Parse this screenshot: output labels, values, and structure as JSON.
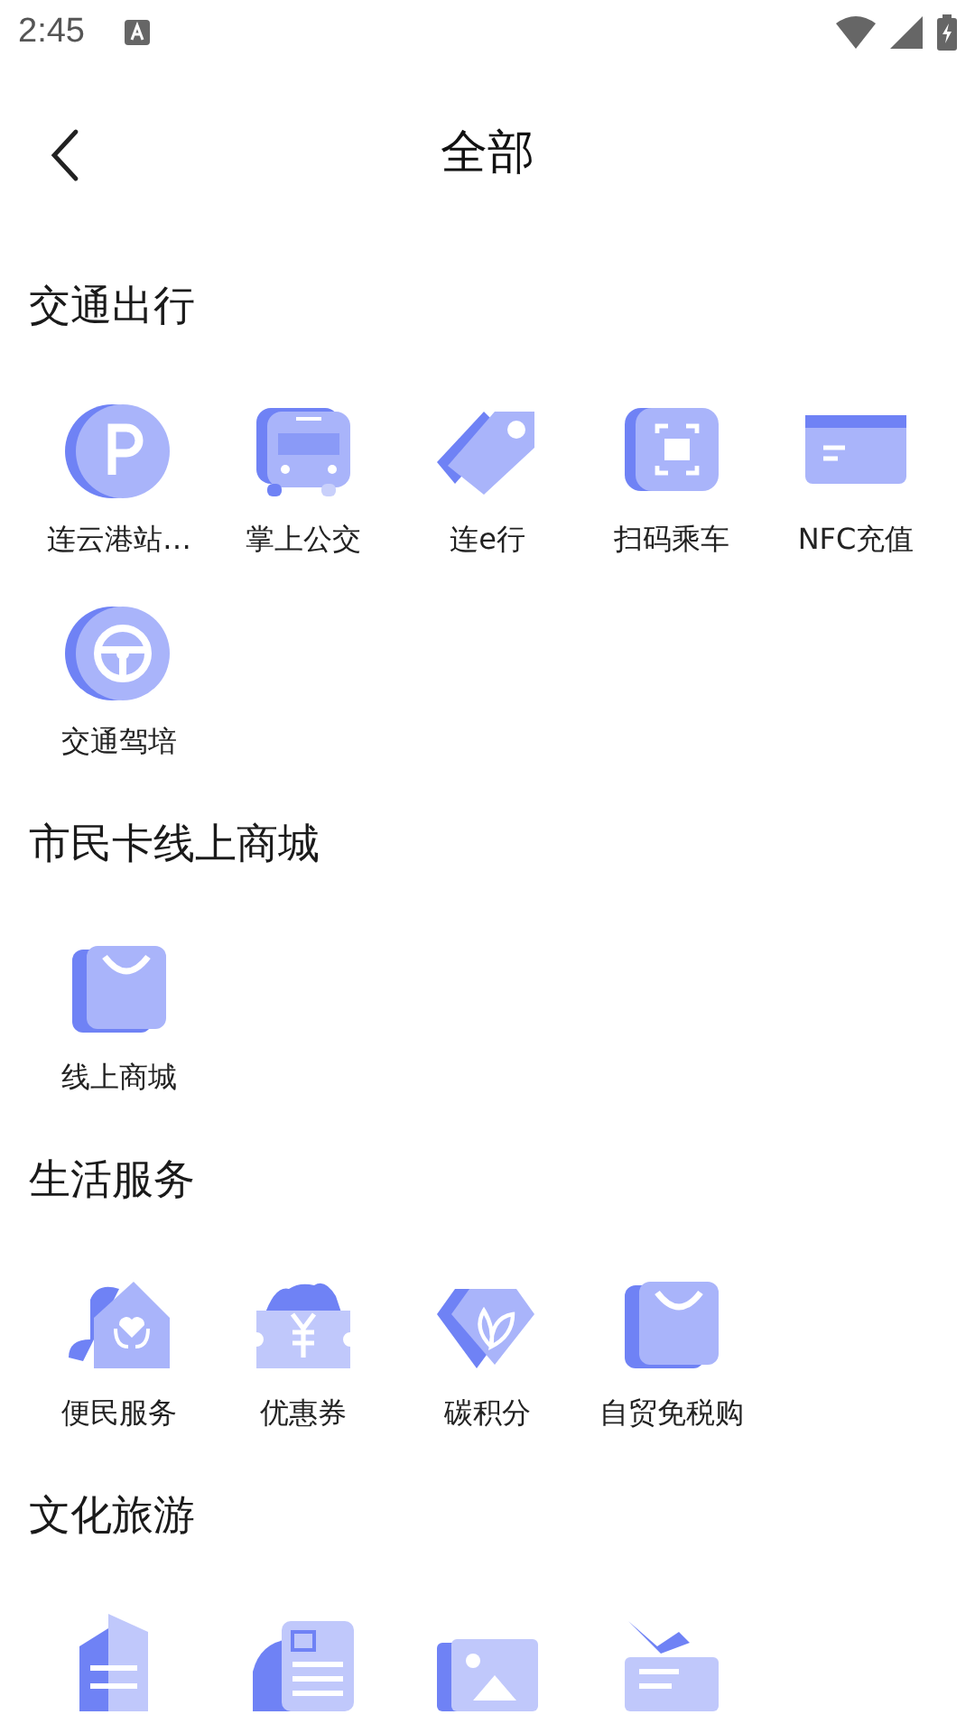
{
  "status_bar": {
    "time": "2:45"
  },
  "header": {
    "title": "全部"
  },
  "sections": [
    {
      "title": "交通出行",
      "items": [
        {
          "kind": "parking",
          "label": "连云港站…"
        },
        {
          "kind": "bus",
          "label": "掌上公交"
        },
        {
          "kind": "tag",
          "label": "连e行"
        },
        {
          "kind": "scan",
          "label": "扫码乘车"
        },
        {
          "kind": "card",
          "label": "NFC充值"
        },
        {
          "kind": "wheel",
          "label": "交通驾培"
        }
      ]
    },
    {
      "title": "市民卡线上商城",
      "items": [
        {
          "kind": "bag",
          "label": "线上商城"
        }
      ]
    },
    {
      "title": "生活服务",
      "items": [
        {
          "kind": "house",
          "label": "便民服务"
        },
        {
          "kind": "coupon",
          "label": "优惠券"
        },
        {
          "kind": "leaf",
          "label": "碳积分"
        },
        {
          "kind": "bag",
          "label": "自贸免税购"
        }
      ]
    },
    {
      "title": "文化旅游",
      "items": [
        {
          "kind": "building"
        },
        {
          "kind": "train"
        },
        {
          "kind": "ticket"
        },
        {
          "kind": "plane"
        }
      ]
    }
  ]
}
